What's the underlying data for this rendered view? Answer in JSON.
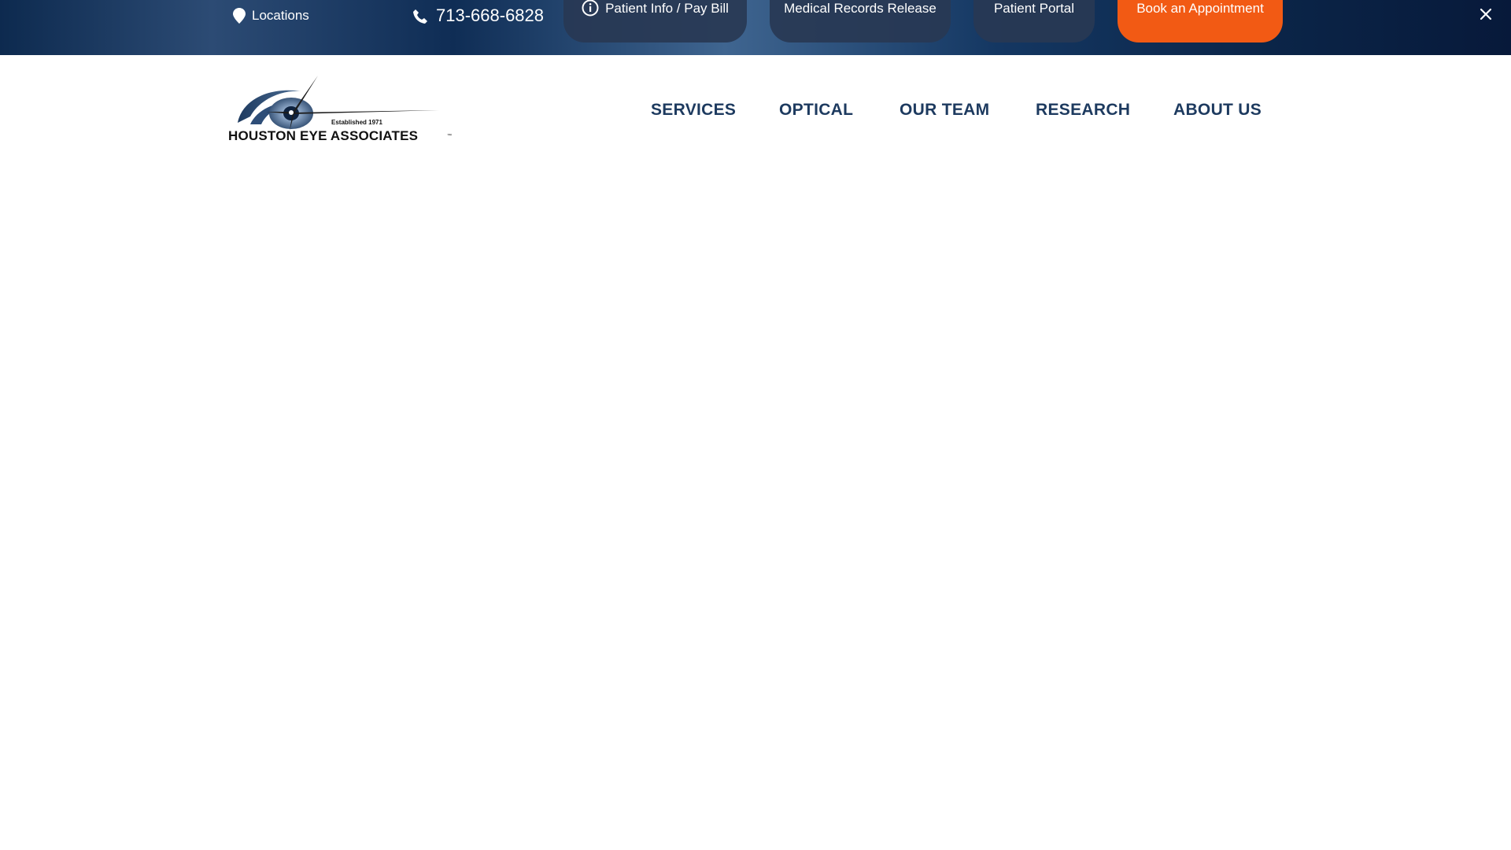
{
  "topbar": {
    "locations_label": "Locations",
    "phone_label": "713-668-6828",
    "patient_info_label": "Patient Info / Pay Bill",
    "records_label": "Medical Records Release",
    "portal_label": "Patient Portal",
    "book_label": "Book an Appointment",
    "close_icon": "close-icon",
    "colors": {
      "bar_dark": "#0d2a4f",
      "pill_bg": "#283854",
      "book_bg": "#f25a14"
    }
  },
  "header": {
    "logo_established": "Established 1971",
    "logo_name": "HOUSTON EYE ASSOCIATES",
    "logo_tm": "™",
    "nav": {
      "services": "SERVICES",
      "optical": "OPTICAL",
      "team": "OUR TEAM",
      "research": "RESEARCH",
      "about": "ABOUT US"
    },
    "colors": {
      "nav_text": "#1d3a5f"
    }
  }
}
